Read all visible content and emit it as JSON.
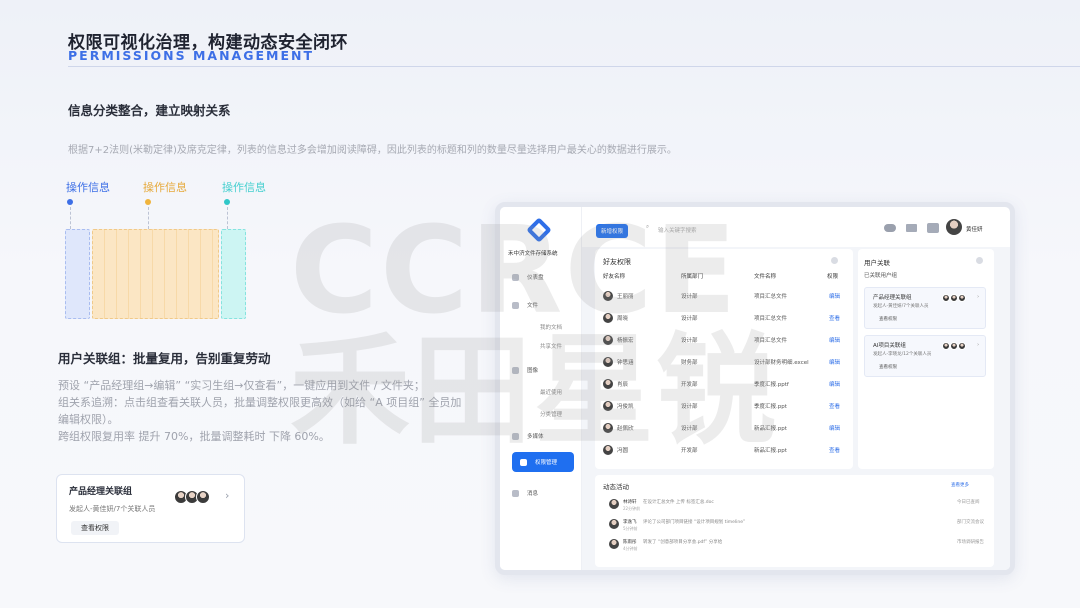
{
  "header": {
    "title": "权限可视化治理，构建动态安全闭环",
    "subtitle": "PERMISSIONS MANAGEMENT"
  },
  "section1": {
    "title": "信息分类整合，建立映射关系",
    "desc": "根据7+2法则(米勒定律)及席克定律，列表的信息过多会增加阅读障碍，因此列表的标题和列的数量尽量选择用户最关心的数据进行展示。"
  },
  "op_labels": [
    "操作信息",
    "操作信息",
    "操作信息"
  ],
  "colors": {
    "blue": "#3d6fe6",
    "orange": "#f0b43c",
    "teal": "#2fc7c8",
    "accent": "#1f6ff0",
    "block_blue": "#dfe7fb",
    "block_orange": "#fbe6c4",
    "block_teal": "#cdf5f3"
  },
  "section2": {
    "title": "用户关联组：批量复用，告别重复劳动",
    "lines": [
      "预设 “产品经理组→编辑” “实习生组→仅查看”，一键应用到文件 / 文件夹；",
      "组关系追溯：点击组查看关联人员，批量调整权限更高效（如给 “A 项目组” 全员加",
      "编辑权限）。",
      "跨组权限复用率 提升 70%，批量调整耗时 下降 60%。"
    ]
  },
  "group_card": {
    "name": "产品经理关联组",
    "info": "发起人-黄佳妍/7个关联人员",
    "button": "查看权限"
  },
  "watermark": "CCRCE 禾田星锐",
  "app": {
    "logo_text": "禾中济文件存储系统",
    "new_button": "新增权限",
    "search_placeholder": "输入关键字搜索",
    "user_name": "黄佳妍",
    "nav": [
      {
        "label": "仪表盘",
        "icon": "dashboard-icon"
      },
      {
        "label": "文件",
        "icon": "folder-icon"
      },
      {
        "label": "我的文档",
        "icon": ""
      },
      {
        "label": "共享文件",
        "icon": ""
      },
      {
        "label": "图像",
        "icon": "image-icon"
      },
      {
        "label": "最近使用",
        "icon": ""
      },
      {
        "label": "分类管理",
        "icon": ""
      },
      {
        "label": "多媒体",
        "icon": "media-icon"
      },
      {
        "label": "权限管理",
        "icon": "permission-icon"
      },
      {
        "label": "消息",
        "icon": "message-icon"
      }
    ],
    "friends_panel": {
      "title": "好友权限",
      "columns": [
        "好友名称",
        "所属部门",
        "文件名称",
        "权限"
      ],
      "rows": [
        {
          "name": "王丽丽",
          "dept": "设计部",
          "file": "项目汇总文件",
          "perm": "编辑"
        },
        {
          "name": "周晓",
          "dept": "设计部",
          "file": "项目汇总文件",
          "perm": "查看"
        },
        {
          "name": "杨振宏",
          "dept": "设计部",
          "file": "项目汇总文件",
          "perm": "编辑"
        },
        {
          "name": "钟思涵",
          "dept": "财务部",
          "file": "设计部财务明细.excel",
          "perm": "编辑"
        },
        {
          "name": "肖辰",
          "dept": "开发部",
          "file": "季度汇报.pptf",
          "perm": "编辑"
        },
        {
          "name": "冯俊凯",
          "dept": "设计部",
          "file": "季度汇报.ppt",
          "perm": "查看"
        },
        {
          "name": "赵佩欣",
          "dept": "设计部",
          "file": "新品汇报.ppt",
          "perm": "编辑"
        },
        {
          "name": "冯圆",
          "dept": "开发部",
          "file": "新品汇报.ppt",
          "perm": "查看"
        }
      ]
    },
    "user_panel": {
      "title": "用户关联",
      "subtitle": "已关联用户组",
      "groups": [
        {
          "name": "产品经理关联组",
          "info": "发起人-黄佳妍/7个关联人员",
          "button": "查看权限"
        },
        {
          "name": "AI项目关联组",
          "info": "发起人-李晓龙/12个关联人员",
          "button": "查看权限"
        }
      ]
    },
    "activity": {
      "title": "动态活动",
      "more": "查看更多",
      "items": [
        {
          "user": "林诗轩",
          "text": "在设计汇总文件 上传 标签汇总.doc",
          "time": "22分钟前",
          "right": "今日已查阅"
        },
        {
          "user": "李逸飞",
          "text": "评论了公司部门项目链接 “设计项目规划 timeline”",
          "time": "5分钟前",
          "right": "部门交流会议"
        },
        {
          "user": "陈雨彤",
          "text": "转发了 “创意部项目分享会.pdf” 分享给",
          "time": "4分钟前",
          "right": "市场调研报告"
        }
      ]
    }
  }
}
